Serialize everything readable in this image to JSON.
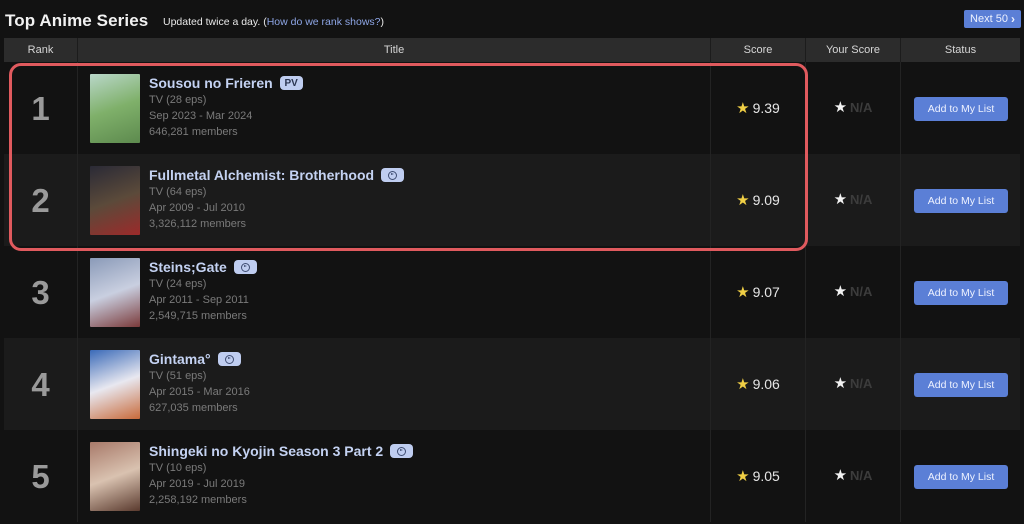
{
  "header": {
    "title": "Top Anime Series",
    "subtitle_text": "Updated twice a day.",
    "subtitle_open": "(",
    "rank_link": "How do we rank shows?",
    "subtitle_close": ")",
    "next_button": "Next 50",
    "next_icon": "chevron-right-icon"
  },
  "columns": [
    "Rank",
    "Title",
    "Score",
    "Your Score",
    "Status"
  ],
  "accent_color": "#5b7fd6",
  "highlight_color": "#e05a5e",
  "rows": [
    {
      "rank": "1",
      "title": "Sousou no Frieren",
      "badge": "PV",
      "type": "TV (28 eps)",
      "aired": "Sep 2023 - Mar 2024",
      "members": "646,281 members",
      "score": "9.39",
      "your_score": "N/A",
      "status_button": "Add to My List",
      "thumb_colors": [
        "#b9d7c9",
        "#7fb06a",
        "#5d8a4e"
      ]
    },
    {
      "rank": "2",
      "title": "Fullmetal Alchemist: Brotherhood",
      "badge": "play-icon",
      "type": "TV (64 eps)",
      "aired": "Apr 2009 - Jul 2010",
      "members": "3,326,112 members",
      "score": "9.09",
      "your_score": "N/A",
      "status_button": "Add to My List",
      "thumb_colors": [
        "#2a2a36",
        "#5b4a3a",
        "#9c2a2a"
      ]
    },
    {
      "rank": "3",
      "title": "Steins;Gate",
      "badge": "play-icon",
      "type": "TV (24 eps)",
      "aired": "Apr 2011 - Sep 2011",
      "members": "2,549,715 members",
      "score": "9.07",
      "your_score": "N/A",
      "status_button": "Add to My List",
      "thumb_colors": [
        "#8a9ab8",
        "#c9cfe0",
        "#7a3a3a"
      ]
    },
    {
      "rank": "4",
      "title": "Gintama°",
      "badge": "play-icon",
      "type": "TV (51 eps)",
      "aired": "Apr 2015 - Mar 2016",
      "members": "627,035 members",
      "score": "9.06",
      "your_score": "N/A",
      "status_button": "Add to My List",
      "thumb_colors": [
        "#3a6ab8",
        "#e8e8f0",
        "#c86a3a"
      ]
    },
    {
      "rank": "5",
      "title": "Shingeki no Kyojin Season 3 Part 2",
      "badge": "play-icon",
      "type": "TV (10 eps)",
      "aired": "Apr 2019 - Jul 2019",
      "members": "2,258,192 members",
      "score": "9.05",
      "your_score": "N/A",
      "status_button": "Add to My List",
      "thumb_colors": [
        "#a87a6a",
        "#d9c2b0",
        "#5a3a2e"
      ]
    }
  ]
}
